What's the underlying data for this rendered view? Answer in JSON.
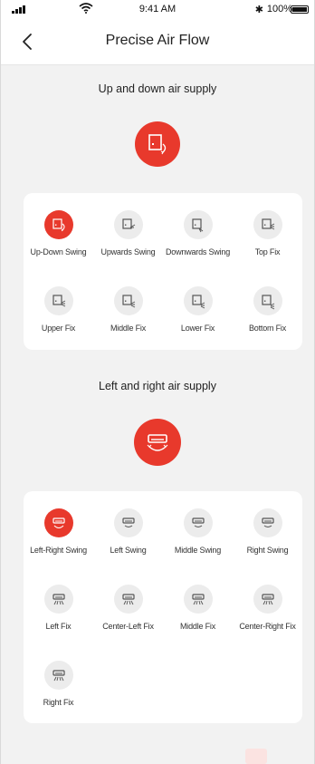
{
  "status": {
    "time": "9:41 AM",
    "battery": "100%",
    "bluetooth": "✱"
  },
  "nav": {
    "title": "Precise Air Flow"
  },
  "updown": {
    "title": "Up and down air supply",
    "items": [
      {
        "label": "Up-Down Swing",
        "active": true
      },
      {
        "label": "Upwards Swing",
        "active": false
      },
      {
        "label": "Downwards Swing",
        "active": false
      },
      {
        "label": "Top Fix",
        "active": false
      },
      {
        "label": "Upper Fix",
        "active": false
      },
      {
        "label": "Middle Fix",
        "active": false
      },
      {
        "label": "Lower Fix",
        "active": false
      },
      {
        "label": "Bottom Fix",
        "active": false
      }
    ]
  },
  "leftright": {
    "title": "Left and right air supply",
    "items": [
      {
        "label": "Left-Right Swing",
        "active": true
      },
      {
        "label": "Left Swing",
        "active": false
      },
      {
        "label": "Middle Swing",
        "active": false
      },
      {
        "label": "Right Swing",
        "active": false
      },
      {
        "label": "Left Fix",
        "active": false
      },
      {
        "label": "Center-Left Fix",
        "active": false
      },
      {
        "label": "Middle Fix",
        "active": false
      },
      {
        "label": "Center-Right Fix",
        "active": false
      },
      {
        "label": "Right Fix",
        "active": false
      }
    ]
  },
  "colors": {
    "accent": "#e8392c",
    "icon_bg": "#ececec",
    "icon_stroke": "#555555"
  }
}
